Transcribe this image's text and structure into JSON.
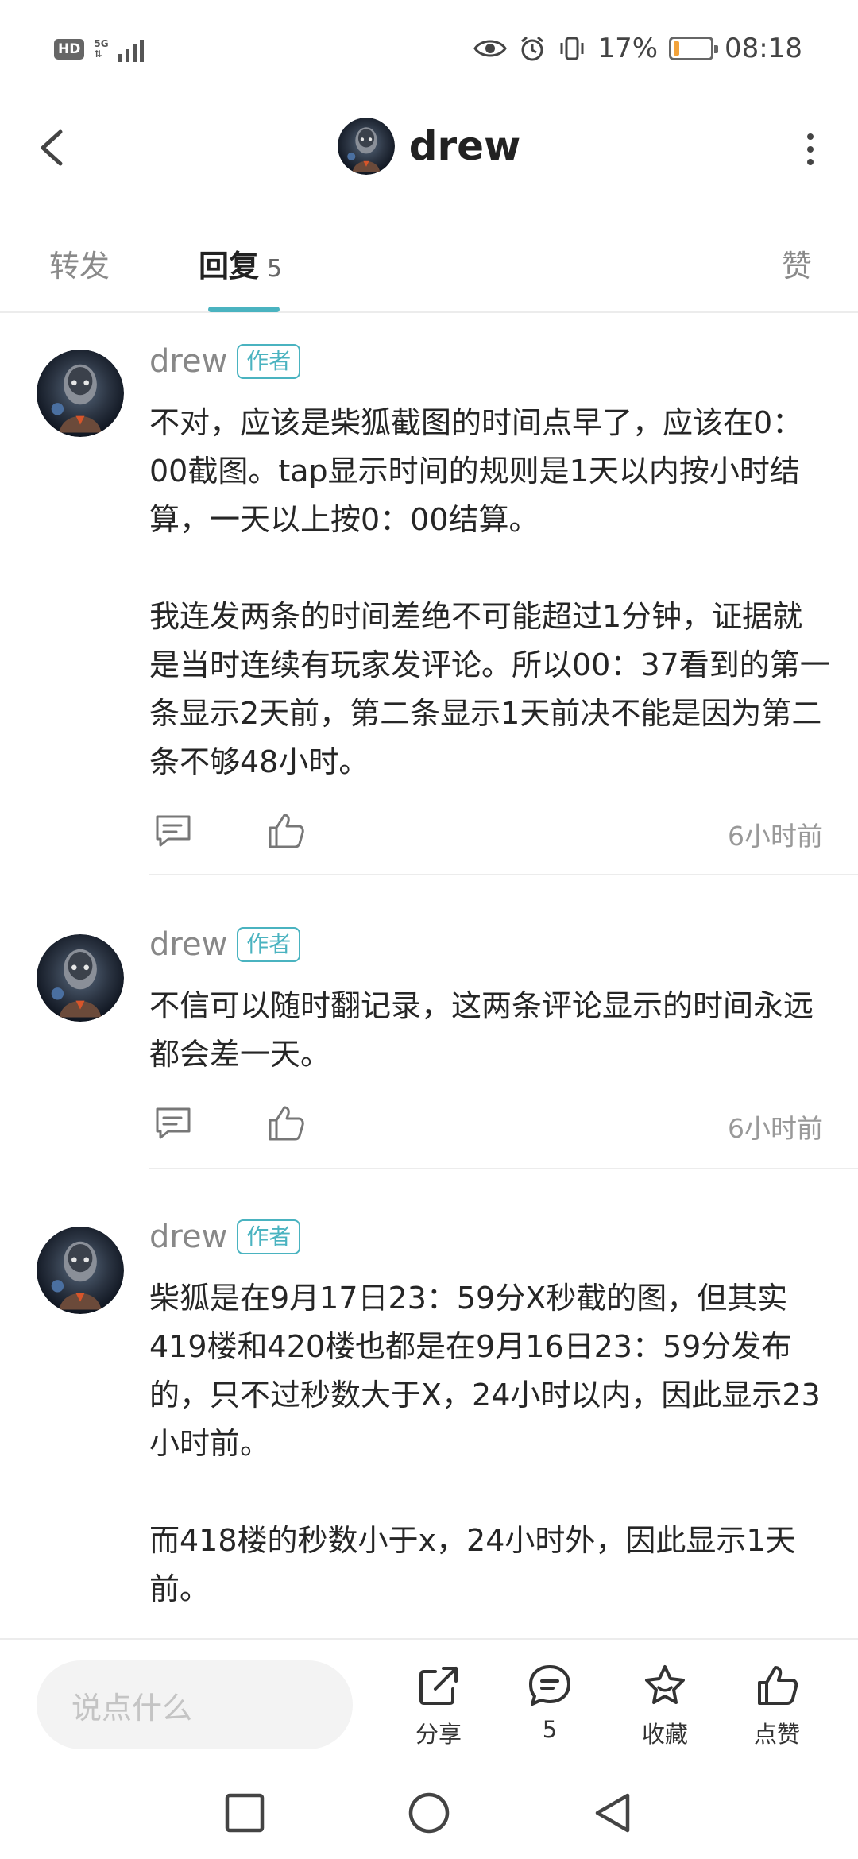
{
  "status_bar": {
    "hd": "HD",
    "network": "5G",
    "battery_percent_text": "17%",
    "battery_level": 0.17,
    "time": "08:18"
  },
  "header": {
    "title": "drew"
  },
  "tabs": [
    {
      "label": "转发"
    },
    {
      "label": "回复",
      "count": "5"
    },
    {
      "label": "赞"
    }
  ],
  "comments": [
    {
      "author": "drew",
      "badge": "作者",
      "text": "不对，应该是柴狐截图的时间点早了，应该在0：00截图。tap显示时间的规则是1天以内按小时结算，一天以上按0：00结算。\n\n我连发两条的时间差绝不可能超过1分钟，证据就是当时连续有玩家发评论。所以00：37看到的第一条显示2天前，第二条显示1天前决不能是因为第二条不够48小时。",
      "time": "6小时前"
    },
    {
      "author": "drew",
      "badge": "作者",
      "text": "不信可以随时翻记录，这两条评论显示的时间永远都会差一天。",
      "time": "6小时前"
    },
    {
      "author": "drew",
      "badge": "作者",
      "text": "柴狐是在9月17日23：59分X秒截的图，但其实419楼和420楼也都是在9月16日23：59分发布的，只不过秒数大于X，24小时以内，因此显示23小时前。\n\n而418楼的秒数小于x，24小时外，因此显示1天前。",
      "time": ""
    }
  ],
  "bottom_bar": {
    "input_placeholder": "说点什么",
    "share_label": "分享",
    "comment_count": "5",
    "favorite_label": "收藏",
    "like_label": "点赞"
  },
  "colors": {
    "accent": "#4ab3c0",
    "battery": "#f2a23a"
  }
}
